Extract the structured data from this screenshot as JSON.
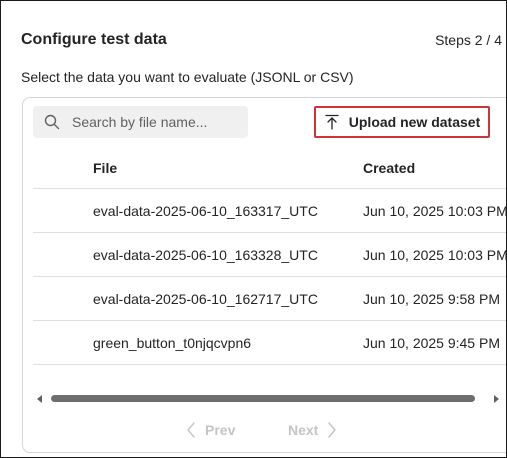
{
  "header": {
    "title": "Configure test data",
    "steps": "Steps 2 / 4",
    "subtitle": "Select the data you want to evaluate (JSONL or CSV)"
  },
  "search": {
    "placeholder": "Search by file name...",
    "icon": "search-icon"
  },
  "upload": {
    "label": "Upload new dataset",
    "icon": "upload-icon",
    "highlight_color": "#d13438"
  },
  "table": {
    "columns": [
      "File",
      "Created"
    ],
    "rows": [
      {
        "file": "eval-data-2025-06-10_163317_UTC",
        "created": "Jun 10, 2025 10:03 PM"
      },
      {
        "file": "eval-data-2025-06-10_163328_UTC",
        "created": "Jun 10, 2025 10:03 PM"
      },
      {
        "file": "eval-data-2025-06-10_162717_UTC",
        "created": "Jun 10, 2025 9:58 PM"
      },
      {
        "file": "green_button_t0njqcvpn6",
        "created": "Jun 10, 2025 9:45 PM"
      }
    ]
  },
  "pagination": {
    "prev_label": "Prev",
    "next_label": "Next",
    "disabled_color": "#c4c4c4"
  }
}
